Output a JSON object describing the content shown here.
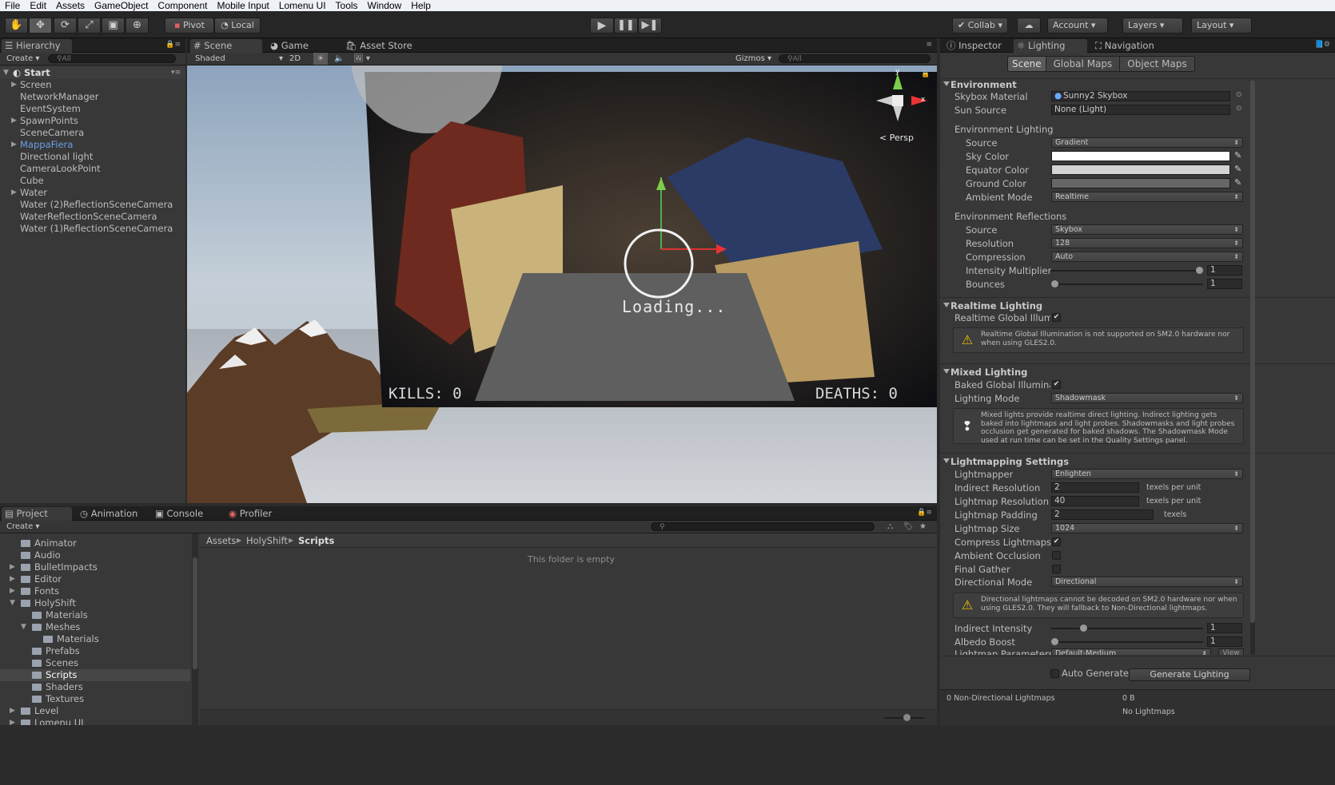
{
  "menu": [
    "File",
    "Edit",
    "Assets",
    "GameObject",
    "Component",
    "Mobile Input",
    "Lomenu UI",
    "Tools",
    "Window",
    "Help"
  ],
  "toolbar": {
    "pivot": "Pivot",
    "local": "Local",
    "collab": "Collab",
    "account": "Account",
    "layers": "Layers",
    "layout": "Layout"
  },
  "hierarchy": {
    "tab": "Hierarchy",
    "create": "Create",
    "search_placeholder": "All",
    "scene_name": "Start",
    "items": [
      {
        "label": "Screen",
        "expandable": true
      },
      {
        "label": "NetworkManager",
        "expandable": false
      },
      {
        "label": "EventSystem",
        "expandable": false
      },
      {
        "label": "SpawnPoints",
        "expandable": true
      },
      {
        "label": "SceneCamera",
        "expandable": false
      },
      {
        "label": "MappaFiera",
        "expandable": true,
        "prefab": true
      },
      {
        "label": "Directional light",
        "expandable": false
      },
      {
        "label": "CameraLookPoint",
        "expandable": false
      },
      {
        "label": "Cube",
        "expandable": false
      },
      {
        "label": "Water",
        "expandable": true
      },
      {
        "label": "Water (2)ReflectionSceneCamera",
        "expandable": false
      },
      {
        "label": "WaterReflectionSceneCamera",
        "expandable": false
      },
      {
        "label": "Water (1)ReflectionSceneCamera",
        "expandable": false
      }
    ]
  },
  "scene_view": {
    "tabs": [
      "Scene",
      "Game",
      "Asset Store"
    ],
    "shading": "Shaded",
    "mode_2d": "2D",
    "gizmos": "Gizmos",
    "search_placeholder": "All",
    "persp": "Persp",
    "gizmo_y": "y",
    "gizmo_x": "x",
    "loading": "Loading...",
    "kills": "KILLS: 0",
    "deaths": "DEATHS: 0"
  },
  "project": {
    "tabs": [
      "Project",
      "Animation",
      "Console",
      "Profiler"
    ],
    "create": "Create",
    "breadcrumb": [
      "Assets",
      "HolyShift",
      "Scripts"
    ],
    "empty_text": "This folder is empty",
    "folders": [
      {
        "label": "Animator",
        "depth": 1,
        "expandable": false
      },
      {
        "label": "Audio",
        "depth": 1,
        "expandable": false
      },
      {
        "label": "BulletImpacts",
        "depth": 1,
        "expandable": true
      },
      {
        "label": "Editor",
        "depth": 1,
        "expandable": true
      },
      {
        "label": "Fonts",
        "depth": 1,
        "expandable": true
      },
      {
        "label": "HolyShift",
        "depth": 1,
        "expandable": true,
        "open": true
      },
      {
        "label": "Materials",
        "depth": 2,
        "expandable": false
      },
      {
        "label": "Meshes",
        "depth": 2,
        "expandable": true,
        "open": true
      },
      {
        "label": "Materials",
        "depth": 3,
        "expandable": false
      },
      {
        "label": "Prefabs",
        "depth": 2,
        "expandable": false
      },
      {
        "label": "Scenes",
        "depth": 2,
        "expandable": false
      },
      {
        "label": "Scripts",
        "depth": 2,
        "expandable": false,
        "selected": true
      },
      {
        "label": "Shaders",
        "depth": 2,
        "expandable": false
      },
      {
        "label": "Textures",
        "depth": 2,
        "expandable": false
      },
      {
        "label": "Level",
        "depth": 1,
        "expandable": true
      },
      {
        "label": "Lomenu UI",
        "depth": 1,
        "expandable": true
      }
    ]
  },
  "inspector": {
    "tabs": [
      "Inspector",
      "Lighting",
      "Navigation"
    ],
    "subtabs": [
      "Scene",
      "Global Maps",
      "Object Maps"
    ],
    "environment": {
      "header": "Environment",
      "skybox_label": "Skybox Material",
      "skybox_value": "Sunny2 Skybox",
      "sun_label": "Sun Source",
      "sun_value": "None (Light)",
      "env_lighting": "Environment Lighting",
      "source_label": "Source",
      "source_value": "Gradient",
      "sky_color_label": "Sky Color",
      "sky_color": "#ffffff",
      "equator_label": "Equator Color",
      "equator_color": "#d2d2d2",
      "ground_label": "Ground Color",
      "ground_color": "#666666",
      "ambient_label": "Ambient Mode",
      "ambient_value": "Realtime",
      "env_reflections": "Environment Reflections",
      "refl_source_label": "Source",
      "refl_source_value": "Skybox",
      "resolution_label": "Resolution",
      "resolution_value": "128",
      "compression_label": "Compression",
      "compression_value": "Auto",
      "intensity_label": "Intensity Multiplier",
      "intensity_value": "1",
      "bounces_label": "Bounces",
      "bounces_value": "1"
    },
    "realtime": {
      "header": "Realtime Lighting",
      "rgi_label": "Realtime Global Illumi",
      "warning": "Realtime Global Illumination is not supported on SM2.0 hardware nor when using GLES2.0."
    },
    "mixed": {
      "header": "Mixed Lighting",
      "baked_label": "Baked Global Illumina",
      "mode_label": "Lighting Mode",
      "mode_value": "Shadowmask",
      "info": "Mixed lights provide realtime direct lighting. Indirect lighting gets baked into lightmaps and light probes. Shadowmasks and light probes occlusion get generated for baked shadows. The Shadowmask Mode used at run time can be set in the Quality Settings panel."
    },
    "lightmapping": {
      "header": "Lightmapping Settings",
      "lightmapper_label": "Lightmapper",
      "lightmapper_value": "Enlighten",
      "indirect_res_label": "Indirect Resolution",
      "indirect_res_value": "2",
      "lightmap_res_label": "Lightmap Resolution",
      "lightmap_res_value": "40",
      "padding_label": "Lightmap Padding",
      "padding_value": "2",
      "texels_per_unit": "texels per unit",
      "texels": "texels",
      "size_label": "Lightmap Size",
      "size_value": "1024",
      "compress_label": "Compress Lightmaps",
      "ao_label": "Ambient Occlusion",
      "fg_label": "Final Gather",
      "dir_mode_label": "Directional Mode",
      "dir_mode_value": "Directional",
      "dir_warning": "Directional lightmaps cannot be decoded on SM2.0 hardware nor when using GLES2.0. They will fallback to Non-Directional lightmaps.",
      "indirect_int_label": "Indirect Intensity",
      "indirect_int_value": "1",
      "albedo_label": "Albedo Boost",
      "albedo_value": "1",
      "params_label": "Lightmap Parameters",
      "params_value": "Default-Medium",
      "view": "View"
    },
    "auto_generate": "Auto Generate",
    "generate_button": "Generate Lighting",
    "stats_left": "0 Non-Directional Lightmaps",
    "stats_size": "0 B",
    "stats_none": "No Lightmaps"
  }
}
